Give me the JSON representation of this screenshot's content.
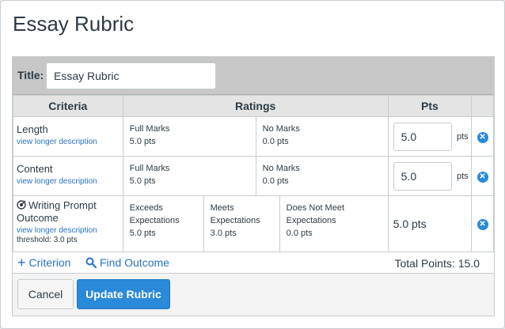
{
  "page": {
    "title": "Essay Rubric"
  },
  "rubric_title": {
    "label": "Title:",
    "value": "Essay Rubric"
  },
  "headers": {
    "criteria": "Criteria",
    "ratings": "Ratings",
    "pts": "Pts"
  },
  "criteria": [
    {
      "name": "Length",
      "link": "view longer description",
      "ratings": [
        {
          "title": "Full Marks",
          "pts": "5.0 pts"
        },
        {
          "title": "No Marks",
          "pts": "0.0 pts"
        }
      ],
      "points": "5.0",
      "unit": "pts"
    },
    {
      "name": "Content",
      "link": "view longer description",
      "ratings": [
        {
          "title": "Full Marks",
          "pts": "5.0 pts"
        },
        {
          "title": "No Marks",
          "pts": "0.0 pts"
        }
      ],
      "points": "5.0",
      "unit": "pts"
    }
  ],
  "outcome": {
    "name_line1": "Writing Prompt",
    "name_line2": "Outcome",
    "link": "view longer description",
    "threshold": "threshold: 3.0 pts",
    "ratings": [
      {
        "title_line1": "Exceeds",
        "title_line2": "Expectations",
        "pts": "5.0 pts"
      },
      {
        "title_line1": "Meets",
        "title_line2": "Expectations",
        "pts": "3.0 pts"
      },
      {
        "title_line1": "Does Not Meet",
        "title_line2": "Expectations",
        "pts": "0.0 pts"
      }
    ],
    "points": "5.0 pts"
  },
  "footer": {
    "add_criterion": "Criterion",
    "find_outcome": "Find Outcome",
    "total_label": "Total Points:",
    "total_value": "15.0"
  },
  "buttons": {
    "cancel": "Cancel",
    "update": "Update Rubric"
  },
  "icons": {
    "delete": "close-circle-icon",
    "add": "plus-icon",
    "search": "search-icon",
    "outcome": "outcome-target-icon"
  },
  "colors": {
    "accent": "#2a89d8",
    "link": "#2773c4"
  }
}
